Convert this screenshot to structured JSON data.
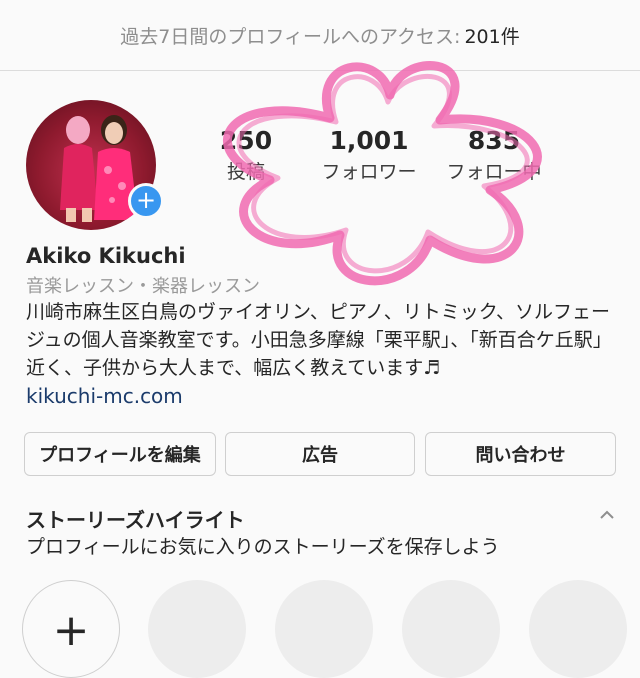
{
  "access_bar": {
    "text": "過去7日間のプロフィールへのアクセス:",
    "count": "201件"
  },
  "profile": {
    "avatar_desc": "profile-photo",
    "add_icon": "+",
    "stats": [
      {
        "value": "250",
        "label": "投稿"
      },
      {
        "value": "1,001",
        "label": "フォロワー"
      },
      {
        "value": "835",
        "label": "フォロー中"
      }
    ],
    "name": "Akiko  Kikuchi",
    "category": "音楽レッスン・楽器レッスン",
    "bio": "川崎市麻生区白鳥のヴァイオリン、ピアノ、リトミック、ソルフェージュの個人音楽教室です。小田急多摩線「栗平駅」、「新百合ケ丘駅」近く、子供から大人まで、幅広く教えています♬",
    "website": "kikuchi-mc.com"
  },
  "buttons": {
    "edit": "プロフィールを編集",
    "ads": "広告",
    "contact": "問い合わせ"
  },
  "highlights": {
    "title": "ストーリーズハイライト",
    "description": "プロフィールにお気に入りのストーリーズを保存しよう",
    "new_icon": "+"
  },
  "colors": {
    "accent": "#3897f0",
    "flower_overlay": "#f06ab0",
    "link": "#1b3b6b"
  }
}
